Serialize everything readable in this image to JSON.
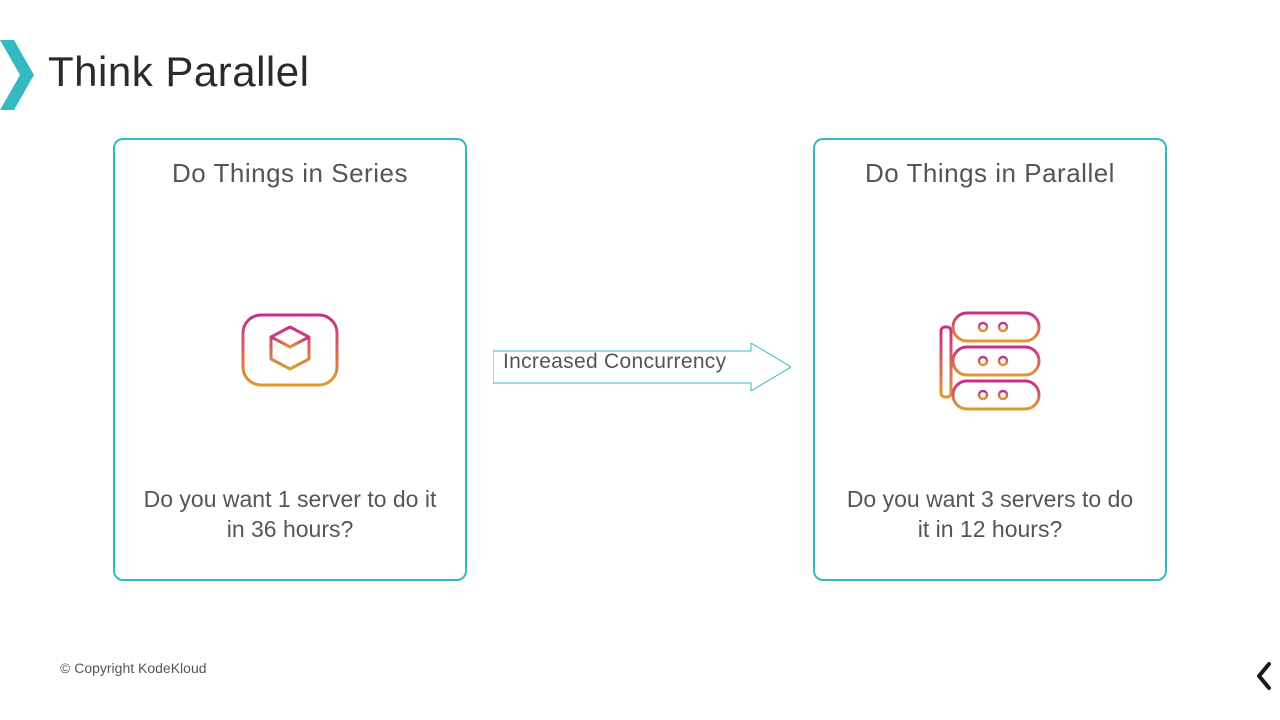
{
  "title": "Think Parallel",
  "cards": {
    "left": {
      "title": "Do Things in Series",
      "question": "Do you want 1 server to do it in 36 hours?"
    },
    "right": {
      "title": "Do Things in Parallel",
      "question": "Do you want 3 servers to do it in 12 hours?"
    }
  },
  "arrow": {
    "label": "Increased Concurrency"
  },
  "footer": {
    "copyright": "© Copyright KodeKloud"
  },
  "colors": {
    "teal": "#34b9c0",
    "gradient_top": "#c42f8a",
    "gradient_bottom": "#e09a2b"
  }
}
